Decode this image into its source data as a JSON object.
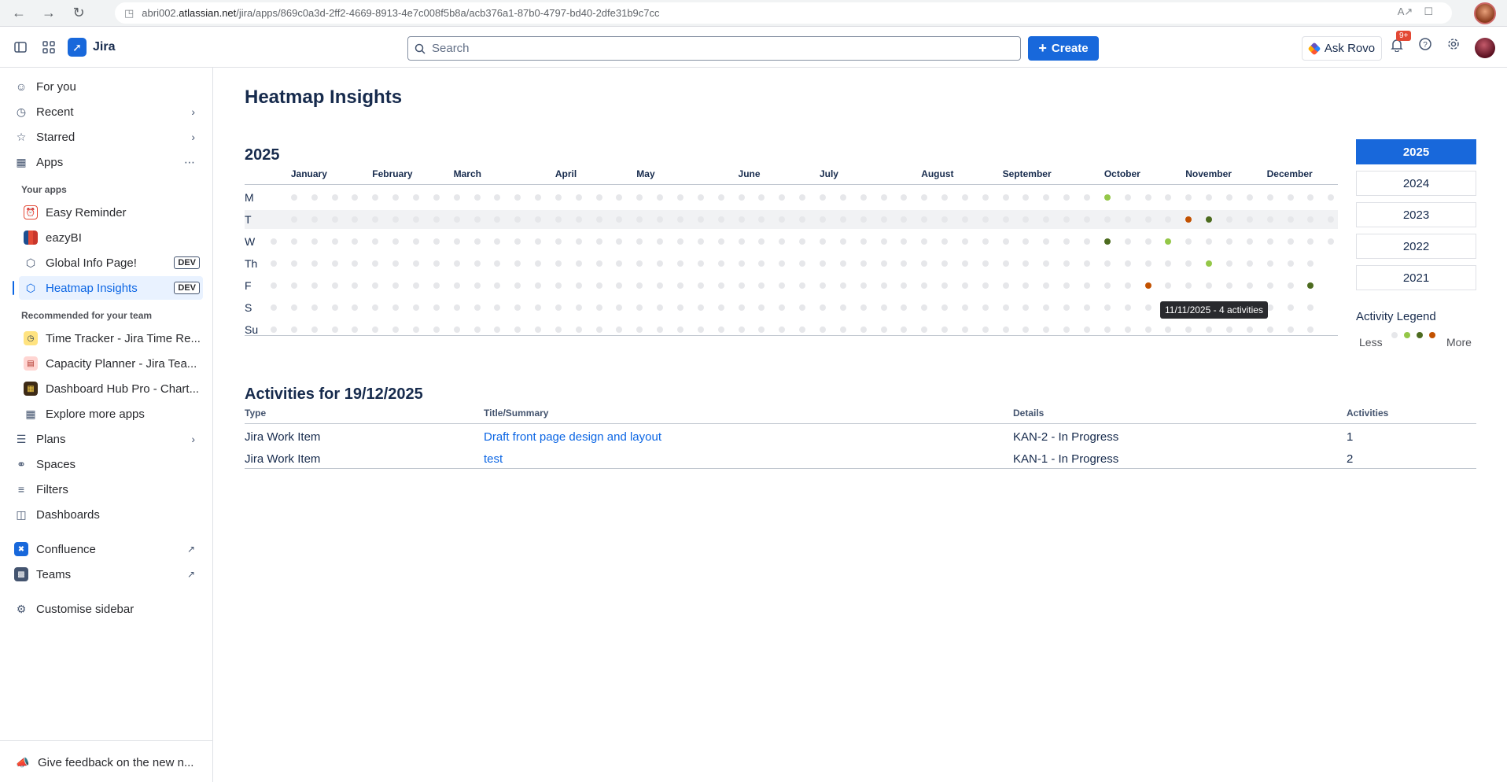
{
  "browser": {
    "url_prefix": "abri002.",
    "url_host": "atlassian.net",
    "url_path": "/jira/apps/869c0a3d-2ff2-4669-8913-4e7c008f5b8a/acb376a1-87b0-4797-bd40-2dfe31b9c7cc"
  },
  "topnav": {
    "product": "Jira",
    "search_placeholder": "Search",
    "create_label": "Create",
    "ask_rovo_label": "Ask Rovo",
    "notifications_badge": "9+"
  },
  "sidebar": {
    "items": {
      "for_you": "For you",
      "recent": "Recent",
      "starred": "Starred",
      "apps": "Apps",
      "your_apps_heading": "Your apps",
      "easy_reminder": "Easy Reminder",
      "eazybi": "eazyBI",
      "global_info": "Global Info Page!",
      "heatmap": "Heatmap Insights",
      "dev_badge": "DEV",
      "recommended_heading": "Recommended for your team",
      "time_tracker": "Time Tracker - Jira Time Re...",
      "capacity_planner": "Capacity Planner - Jira Tea...",
      "dashboard_hub": "Dashboard Hub Pro - Chart...",
      "explore_apps": "Explore more apps",
      "plans": "Plans",
      "spaces": "Spaces",
      "filters": "Filters",
      "dashboards": "Dashboards",
      "confluence": "Confluence",
      "teams": "Teams",
      "customise": "Customise sidebar",
      "feedback": "Give feedback on the new n..."
    }
  },
  "main": {
    "page_title": "Heatmap Insights",
    "year_title": "2025",
    "months": [
      "January",
      "February",
      "March",
      "April",
      "May",
      "June",
      "July",
      "August",
      "September",
      "October",
      "November",
      "December"
    ],
    "days": [
      "M",
      "T",
      "W",
      "Th",
      "F",
      "S",
      "Su"
    ],
    "tooltip": "11/11/2025 - 4 activities",
    "year_buttons": [
      "2025",
      "2024",
      "2023",
      "2022",
      "2021"
    ],
    "selected_year": "2025",
    "legend_title": "Activity Legend",
    "legend_less": "Less",
    "legend_more": "More",
    "legend_colors": [
      "#e6e7ea",
      "#94c748",
      "#4c6b1f",
      "#c25100"
    ],
    "activities_title": "Activities for 19/12/2025",
    "table_headers": [
      "Type",
      "Title/Summary",
      "Details",
      "Activities"
    ],
    "table_rows": [
      [
        "Jira Work Item",
        "Draft front page design and layout",
        "KAN-2 - In Progress",
        "1"
      ],
      [
        "Jira Work Item",
        "test",
        "KAN-1 - In Progress",
        "2"
      ]
    ]
  },
  "chart_data": {
    "type": "heatmap",
    "title": "2025",
    "x_categories": [
      "January",
      "February",
      "March",
      "April",
      "May",
      "June",
      "July",
      "August",
      "September",
      "October",
      "November",
      "December"
    ],
    "y_categories": [
      "M",
      "T",
      "W",
      "Th",
      "F",
      "S",
      "Su"
    ],
    "active_cells": [
      {
        "week": 41,
        "day": "M",
        "color": "#94c748"
      },
      {
        "week": 45,
        "day": "T",
        "color": "#c25100"
      },
      {
        "week": 46,
        "day": "T",
        "color": "#4c6b1f"
      },
      {
        "week": 41,
        "day": "W",
        "color": "#4c6b1f"
      },
      {
        "week": 44,
        "day": "W",
        "color": "#94c748"
      },
      {
        "week": 46,
        "day": "Th",
        "color": "#94c748"
      },
      {
        "week": 43,
        "day": "F",
        "color": "#c25100"
      },
      {
        "week": 51,
        "day": "F",
        "color": "#4c6b1f"
      }
    ],
    "legend": [
      "Less",
      "More"
    ]
  }
}
